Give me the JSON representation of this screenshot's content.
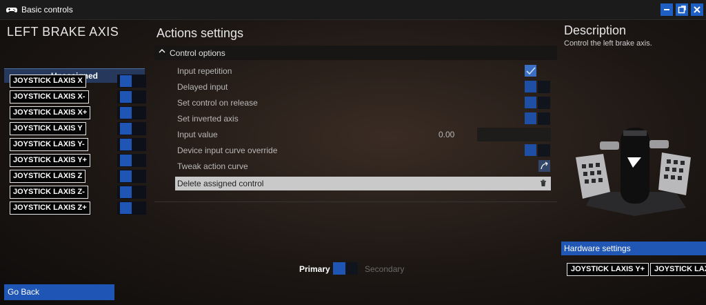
{
  "window": {
    "title": "Basic controls",
    "buttons": [
      "minimize-icon",
      "restore-icon",
      "close-icon"
    ]
  },
  "left_panel": {
    "heading": "LEFT BRAKE AXIS",
    "status": "Unassigned",
    "bindings": [
      "JOYSTICK LAXIS X",
      "JOYSTICK LAXIS X-",
      "JOYSTICK LAXIS X+",
      "JOYSTICK LAXIS Y",
      "JOYSTICK LAXIS Y-",
      "JOYSTICK LAXIS Y+",
      "JOYSTICK LAXIS Z",
      "JOYSTICK LAXIS Z-",
      "JOYSTICK LAXIS Z+"
    ]
  },
  "actions": {
    "heading": "Actions settings",
    "section": "Control options",
    "options": {
      "input_repetition": {
        "label": "Input repetition",
        "checked": true
      },
      "delayed_input": {
        "label": "Delayed input",
        "checked": false
      },
      "set_control_on_release": {
        "label": "Set control on release",
        "checked": false
      },
      "set_inverted_axis": {
        "label": "Set inverted axis",
        "checked": false
      },
      "input_value": {
        "label": "Input value",
        "value": "0.00"
      },
      "device_input_curve_override": {
        "label": "Device input curve override",
        "checked": false
      },
      "tweak_action_curve": {
        "label": "Tweak action curve"
      },
      "delete_assigned_control": {
        "label": "Delete assigned control"
      }
    },
    "toggle": {
      "primary": "Primary",
      "secondary": "Secondary"
    }
  },
  "description": {
    "heading": "Description",
    "text": "Control the left brake axis."
  },
  "hardware": {
    "header": "Hardware settings",
    "bindings": [
      "JOYSTICK LAXIS Y+",
      "JOYSTICK LAXIS Z+"
    ]
  },
  "footer": {
    "go_back": "Go Back"
  },
  "colors": {
    "accent": "#1f56b5",
    "checkbox_on": "#3b6fc4"
  }
}
